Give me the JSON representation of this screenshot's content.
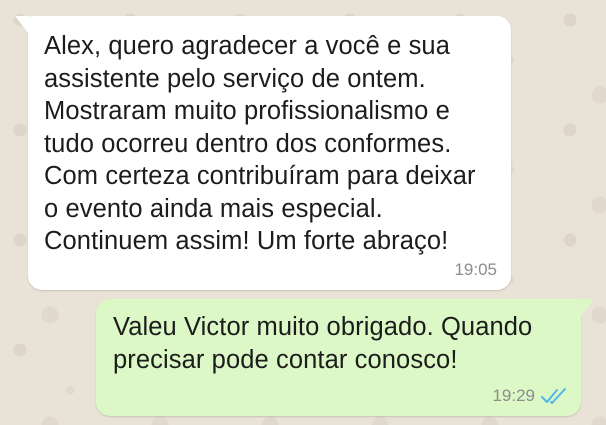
{
  "chat": {
    "messages": [
      {
        "direction": "incoming",
        "text": "Alex, quero agradecer a você e sua\nassistente pelo serviço de ontem.\nMostraram muito profissionalismo e\ntudo ocorreu dentro dos conformes.\nCom certeza contribuíram para deixar\no evento ainda mais especial.\nContinuem assim! Um forte abraço!",
        "time": "19:05"
      },
      {
        "direction": "outgoing",
        "text": "Valeu Victor muito obrigado. Quando\nprecisar pode contar conosco!",
        "time": "19:29",
        "status_icon": "double-check-read-icon"
      }
    ]
  },
  "colors": {
    "wallpaper": "#e9e2d7",
    "incoming_bubble": "#ffffff",
    "outgoing_bubble": "#dcf8c6",
    "read_check": "#4fb6ec",
    "timestamp": "#8c8c8c"
  }
}
